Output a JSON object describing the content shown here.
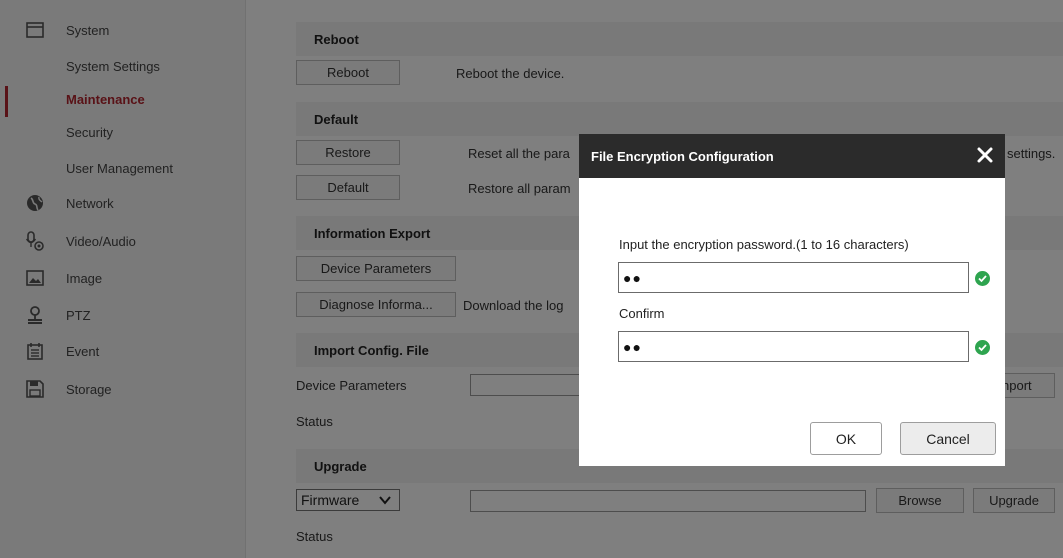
{
  "sidebar": {
    "system": "System",
    "system_settings": "System Settings",
    "maintenance": "Maintenance",
    "security": "Security",
    "user_management": "User Management",
    "network": "Network",
    "video_audio": "Video/Audio",
    "image": "Image",
    "ptz": "PTZ",
    "event": "Event",
    "storage": "Storage"
  },
  "reboot": {
    "heading": "Reboot",
    "button": "Reboot",
    "description": "Reboot the device."
  },
  "default": {
    "heading": "Default",
    "restore_button": "Restore",
    "restore_desc_left": "Reset all the para",
    "restore_desc_right": "settings.",
    "default_button": "Default",
    "default_desc": "Restore all param"
  },
  "export": {
    "heading": "Information Export",
    "device_params_button": "Device Parameters",
    "diagnose_button": "Diagnose Informa...",
    "diagnose_desc": "Download the log"
  },
  "import": {
    "heading": "Import Config. File",
    "device_params_label": "Device Parameters",
    "import_button": "nport",
    "status_label": "Status"
  },
  "upgrade": {
    "heading": "Upgrade",
    "select_value": "Firmware",
    "browse_button": "Browse",
    "upgrade_button": "Upgrade",
    "status_label": "Status"
  },
  "dialog": {
    "title": "File Encryption Configuration",
    "password_label": "Input the encryption password.(1 to 16 characters)",
    "password_value": "●●",
    "confirm_label": "Confirm",
    "confirm_value": "●●",
    "ok_button": "OK",
    "cancel_button": "Cancel"
  },
  "colors": {
    "accent": "#b3242e",
    "dialog_header": "#2b2b2b",
    "valid_check": "#2ea44f"
  }
}
